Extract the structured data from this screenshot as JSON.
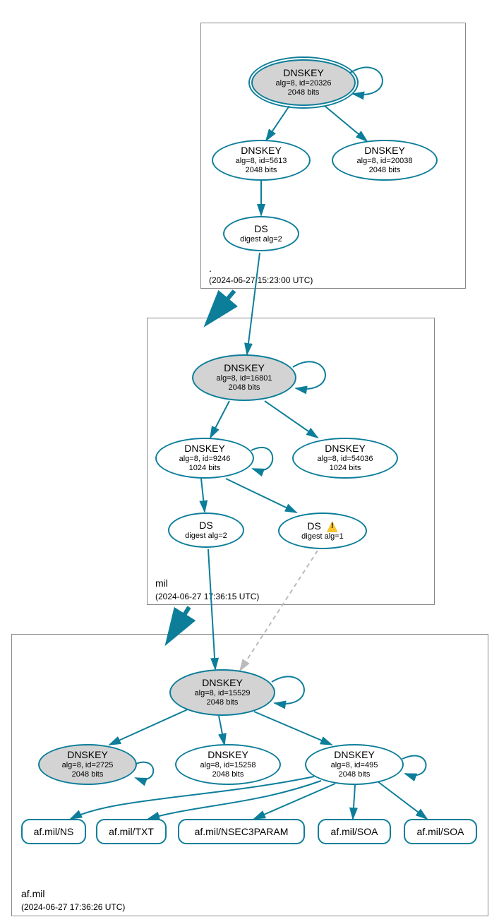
{
  "zones": {
    "root": {
      "label": ".",
      "date": "(2024-06-27 15:23:00 UTC)"
    },
    "mil": {
      "label": "mil",
      "date": "(2024-06-27 17:36:15 UTC)"
    },
    "afmil": {
      "label": "af.mil",
      "date": "(2024-06-27 17:36:26 UTC)"
    }
  },
  "nodes": {
    "root_ksk": {
      "title": "DNSKEY",
      "alg": "alg=8, id=20326",
      "bits": "2048 bits"
    },
    "root_zsk1": {
      "title": "DNSKEY",
      "alg": "alg=8, id=5613",
      "bits": "2048 bits"
    },
    "root_zsk2": {
      "title": "DNSKEY",
      "alg": "alg=8, id=20038",
      "bits": "2048 bits"
    },
    "root_ds": {
      "title": "DS",
      "sub": "digest alg=2"
    },
    "mil_ksk": {
      "title": "DNSKEY",
      "alg": "alg=8, id=16801",
      "bits": "2048 bits"
    },
    "mil_zsk1": {
      "title": "DNSKEY",
      "alg": "alg=8, id=9246",
      "bits": "1024 bits"
    },
    "mil_zsk2": {
      "title": "DNSKEY",
      "alg": "alg=8, id=54036",
      "bits": "1024 bits"
    },
    "mil_ds1": {
      "title": "DS",
      "sub": "digest alg=2"
    },
    "mil_ds2": {
      "title": "DS",
      "sub": "digest alg=1"
    },
    "af_ksk": {
      "title": "DNSKEY",
      "alg": "alg=8, id=15529",
      "bits": "2048 bits"
    },
    "af_k2": {
      "title": "DNSKEY",
      "alg": "alg=8, id=2725",
      "bits": "2048 bits"
    },
    "af_k3": {
      "title": "DNSKEY",
      "alg": "alg=8, id=15258",
      "bits": "2048 bits"
    },
    "af_k4": {
      "title": "DNSKEY",
      "alg": "alg=8, id=495",
      "bits": "2048 bits"
    },
    "rr_ns": {
      "title": "af.mil/NS"
    },
    "rr_txt": {
      "title": "af.mil/TXT"
    },
    "rr_nsec": {
      "title": "af.mil/NSEC3PARAM"
    },
    "rr_soa1": {
      "title": "af.mil/SOA"
    },
    "rr_soa2": {
      "title": "af.mil/SOA"
    }
  }
}
